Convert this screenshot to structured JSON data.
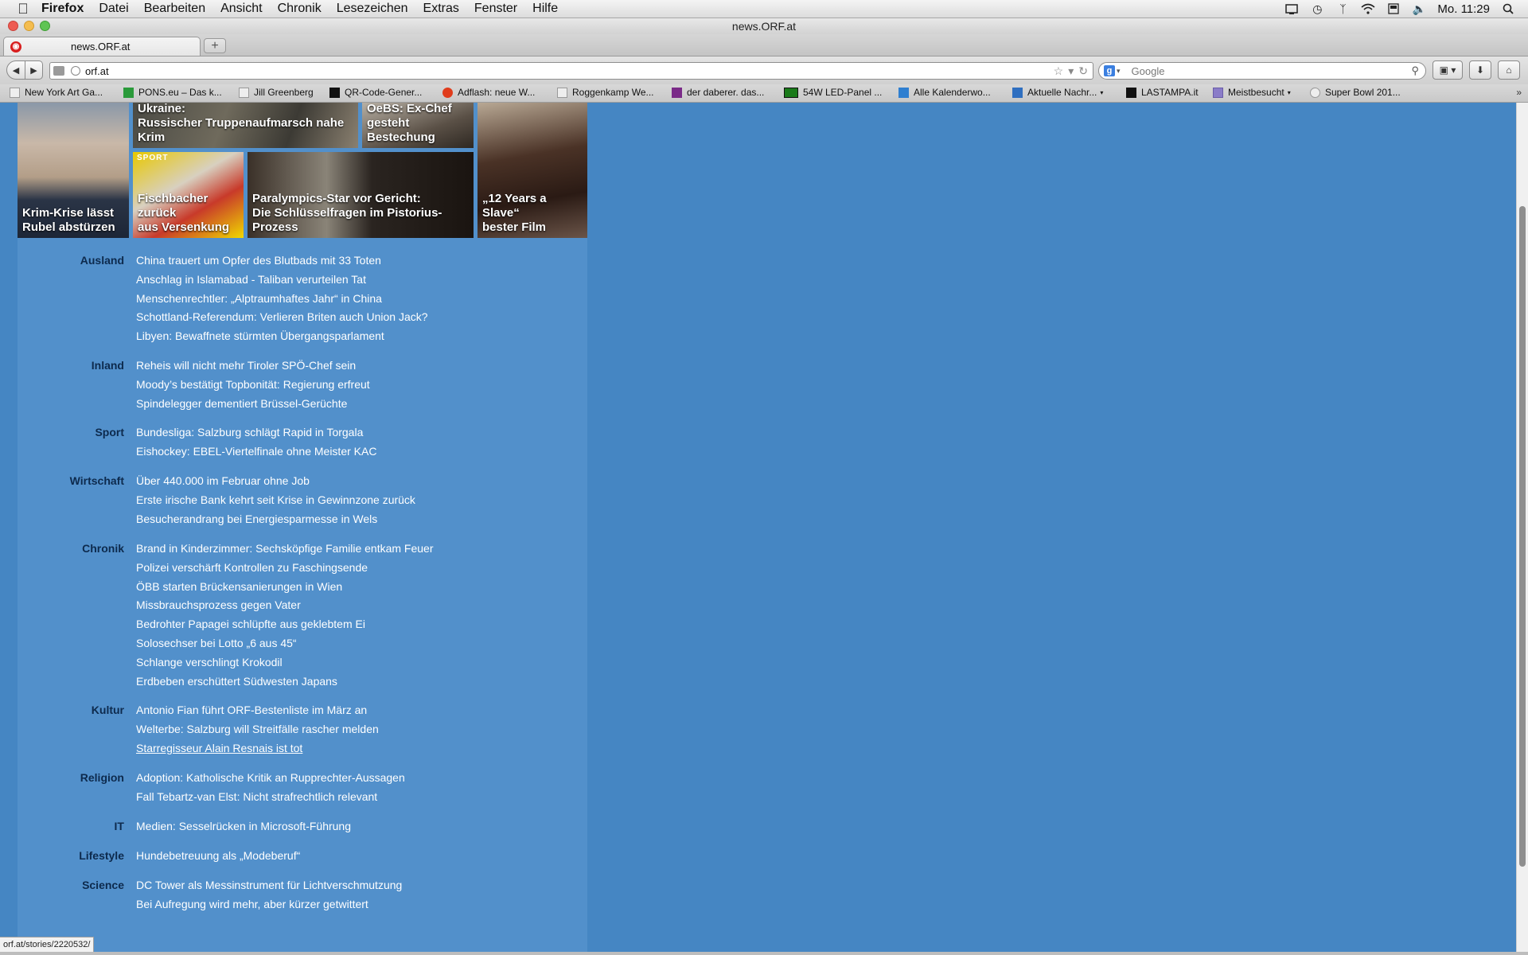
{
  "menubar": {
    "app": "Firefox",
    "items": [
      "Datei",
      "Bearbeiten",
      "Ansicht",
      "Chronik",
      "Lesezeichen",
      "Extras",
      "Fenster",
      "Hilfe"
    ],
    "clock": "Mo. 11:29",
    "icons": [
      "display-icon",
      "time-machine-icon",
      "bluetooth-icon",
      "wifi-icon",
      "flag-icon",
      "volume-icon",
      "spotlight-icon"
    ]
  },
  "window": {
    "title": "news.ORF.at"
  },
  "tab": {
    "title": "news.ORF.at"
  },
  "nav": {
    "url": "orf.at",
    "search_placeholder": "Google"
  },
  "bookmarks": [
    "New York Art Ga...",
    "PONS.eu – Das k...",
    "Jill Greenberg",
    "QR-Code-Gener...",
    "Adflash: neue W...",
    "Roggenkamp We...",
    "der daberer. das...",
    "54W LED-Panel ...",
    "Alle Kalenderwo...",
    "Aktuelle Nachr...",
    "LASTAMPA.it",
    "Meistbesucht",
    "Super Bowl 201..."
  ],
  "tiles": {
    "putin": "Krim-Krise lässt Rubel abstürzen",
    "ukraine_l1": "Ukraine:",
    "ukraine_l2": "Russischer Truppenaufmarsch nahe Krim",
    "oebs_l1": "OeBS: Ex-Chef",
    "oebs_l2": "gesteht Bestechung",
    "sport_tag": "SPORT",
    "fischbacher_l1": "Fischbacher zurück",
    "fischbacher_l2": "aus Versenkung",
    "pistorius_l1": "Paralympics-Star vor Gericht:",
    "pistorius_l2": "Die Schlüsselfragen im Pistorius-Prozess",
    "slave_l1": "„12 Years a Slave“",
    "slave_l2": "bester Film"
  },
  "sections": [
    {
      "label": "Ausland",
      "items": [
        "China trauert um Opfer des Blutbads mit 33 Toten",
        "Anschlag in Islamabad - Taliban verurteilen Tat",
        "Menschenrechtler: „Alptraumhaftes Jahr“ in China",
        "Schottland-Referendum: Verlieren Briten auch Union Jack?",
        "Libyen: Bewaffnete stürmten Übergangsparlament"
      ]
    },
    {
      "label": "Inland",
      "items": [
        "Reheis will nicht mehr Tiroler SPÖ-Chef sein",
        "Moody’s bestätigt Topbonität: Regierung erfreut",
        "Spindelegger dementiert Brüssel-Gerüchte"
      ]
    },
    {
      "label": "Sport",
      "items": [
        "Bundesliga: Salzburg schlägt Rapid in Torgala",
        "Eishockey: EBEL-Viertelfinale ohne Meister KAC"
      ]
    },
    {
      "label": "Wirtschaft",
      "items": [
        "Über 440.000 im Februar ohne Job",
        "Erste irische Bank kehrt seit Krise in Gewinnzone zurück",
        "Besucherandrang bei Energiesparmesse in Wels"
      ]
    },
    {
      "label": "Chronik",
      "items": [
        "Brand in Kinderzimmer: Sechsköpfige Familie entkam Feuer",
        "Polizei verschärft Kontrollen zu Faschingsende",
        "ÖBB starten Brückensanierungen in Wien",
        "Missbrauchsprozess gegen Vater",
        "Bedrohter Papagei schlüpfte aus geklebtem Ei",
        "Solosechser bei Lotto „6 aus 45“",
        "Schlange verschlingt Krokodil",
        "Erdbeben erschüttert Südwesten Japans"
      ]
    },
    {
      "label": "Kultur",
      "items": [
        "Antonio Fian führt ORF-Bestenliste im März an",
        "Welterbe: Salzburg will Streitfälle rascher melden",
        "Starregisseur Alain Resnais ist tot"
      ]
    },
    {
      "label": "Religion",
      "items": [
        "Adoption: Katholische Kritik an Rupprechter-Aussagen",
        "Fall Tebartz-van Elst: Nicht strafrechtlich relevant"
      ]
    },
    {
      "label": "IT",
      "items": [
        "Medien: Sesselrücken in Microsoft-Führung"
      ]
    },
    {
      "label": "Lifestyle",
      "items": [
        "Hundebetreuung als „Modeberuf“"
      ]
    },
    {
      "label": "Science",
      "items": [
        "DC Tower als Messinstrument für Lichtverschmutzung",
        "Bei Aufregung wird mehr, aber kürzer getwittert"
      ]
    }
  ],
  "status": {
    "url": "orf.at/stories/2220532/"
  }
}
